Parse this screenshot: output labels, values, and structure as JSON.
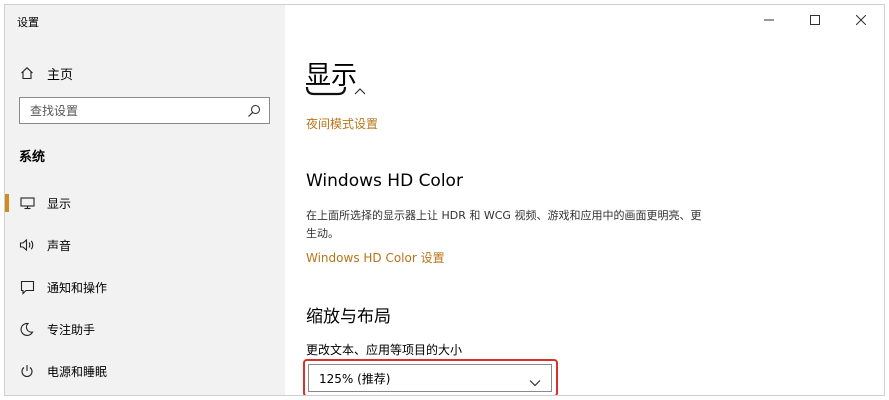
{
  "window": {
    "title": "设置",
    "controls": {
      "minimize": "–",
      "maximize": "☐",
      "close": "✕"
    }
  },
  "sidebar": {
    "home_label": "主页",
    "search_placeholder": "查找设置",
    "section_title": "系统",
    "items": [
      {
        "label": "显示",
        "icon": "monitor-icon",
        "active": true
      },
      {
        "label": "声音",
        "icon": "speaker-icon",
        "active": false
      },
      {
        "label": "通知和操作",
        "icon": "notification-icon",
        "active": false
      },
      {
        "label": "专注助手",
        "icon": "moon-icon",
        "active": false
      },
      {
        "label": "电源和睡眠",
        "icon": "power-icon",
        "active": false
      }
    ]
  },
  "main": {
    "page_title": "显示",
    "night_light_link": "夜间模式设置",
    "hd_color": {
      "heading": "Windows HD Color",
      "description": "在上面所选择的显示器上让 HDR 和 WCG 视频、游戏和应用中的画面更明亮、更生动。",
      "link": "Windows HD Color 设置"
    },
    "scale": {
      "heading": "缩放与布局",
      "label": "更改文本、应用等项目的大小",
      "selected": "125% (推荐)"
    }
  },
  "colors": {
    "accent": "#cf8c25",
    "link": "#b8751a",
    "highlight_border": "#d9302a",
    "sidebar_bg": "#f2f2f2"
  }
}
